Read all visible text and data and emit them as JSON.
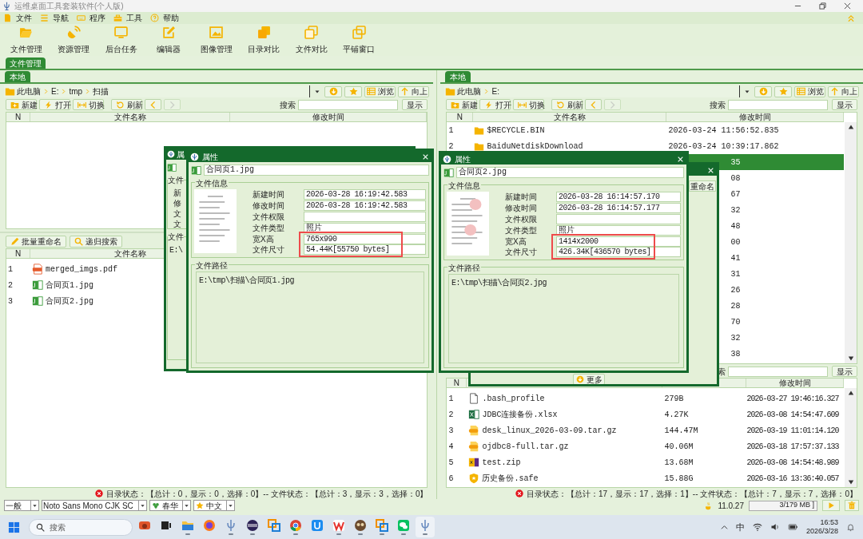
{
  "window": {
    "title": "运维桌面工具套装软件(个人版)"
  },
  "menu": [
    {
      "label": "文件"
    },
    {
      "label": "导航"
    },
    {
      "label": "程序"
    },
    {
      "label": "工具"
    },
    {
      "label": "帮助"
    }
  ],
  "toolbar": [
    {
      "label": "文件管理"
    },
    {
      "label": "资源管理"
    },
    {
      "label": "后台任务"
    },
    {
      "label": "编辑器"
    },
    {
      "label": "图像管理"
    },
    {
      "label": "目录对比"
    },
    {
      "label": "文件对比"
    },
    {
      "label": "平铺窗口"
    }
  ],
  "main_tabs": [
    {
      "label": "文件管理",
      "selected": true
    }
  ],
  "panes": [
    {
      "tab": {
        "label": "本地",
        "selected": true
      },
      "path": [
        "此电脑",
        "E:",
        "tmp",
        "扫描"
      ],
      "nav_buttons": [
        {
          "label": "浏览"
        },
        {
          "label": "向上"
        }
      ],
      "buttons": [
        {
          "label": "新建",
          "disabled": false
        },
        {
          "label": "打开",
          "disabled": false
        },
        {
          "label": "切换",
          "disabled": false
        },
        {
          "label": "刷新",
          "disabled": false
        },
        {
          "disabled": false
        },
        {
          "disabled": true
        }
      ],
      "search_label": "搜索",
      "show_button": "显示",
      "dir_table": {
        "columns": [
          "N",
          "文件名称",
          "修改时间"
        ]
      },
      "file_tools": [
        {
          "label": "批量重命名"
        },
        {
          "label": "递归搜索"
        }
      ],
      "file_table": {
        "columns": [
          "N",
          "文件名称"
        ],
        "rows": [
          {
            "n": "1",
            "name": "merged_imgs.pdf",
            "kind": "pdf"
          },
          {
            "n": "2",
            "name": "合同页1.jpg",
            "kind": "jpg"
          },
          {
            "n": "3",
            "name": "合同页2.jpg",
            "kind": "jpg"
          }
        ]
      },
      "status": "目录状态：【总计：0，显示：0，选择：0】-- 文件状态：【总计：3，显示：3，选择：0】"
    },
    {
      "tab": {
        "label": "本地",
        "selected": true
      },
      "path": [
        "此电脑",
        "E:"
      ],
      "nav_buttons": [
        {
          "label": "浏览"
        },
        {
          "label": "向上"
        }
      ],
      "buttons": [
        {
          "label": "新建",
          "disabled": false
        },
        {
          "label": "打开",
          "disabled": false
        },
        {
          "label": "切换",
          "disabled": false
        },
        {
          "label": "刷新",
          "disabled": false
        },
        {
          "disabled": false
        },
        {
          "disabled": true
        }
      ],
      "search_label": "搜索",
      "show_button": "显示",
      "dir_table": {
        "columns": [
          "N",
          "文件名称",
          "修改时间"
        ],
        "rows": [
          {
            "n": "1",
            "name": "$RECYCLE.BIN",
            "kind": "folder",
            "modified": "2026-03-24 11:56:52.835",
            "selected": false
          },
          {
            "n": "2",
            "name": "BaiduNetdiskDownload",
            "kind": "folder",
            "modified": "2026-03-24 10:39:17.862",
            "selected": false
          },
          {
            "modified": "35",
            "selected": true
          },
          {
            "modified": "08",
            "selected": false
          },
          {
            "modified": "67",
            "selected": false
          },
          {
            "modified": "32",
            "selected": false
          },
          {
            "modified": "48",
            "selected": false
          },
          {
            "modified": "00",
            "selected": false
          },
          {
            "modified": "41",
            "selected": false
          },
          {
            "modified": "31",
            "selected": false
          },
          {
            "modified": "26",
            "selected": false
          },
          {
            "modified": "28",
            "selected": false
          },
          {
            "modified": "70",
            "selected": false
          },
          {
            "modified": "32",
            "selected": false
          },
          {
            "modified": "38",
            "selected": false
          }
        ]
      },
      "lower_search": {
        "label": "索",
        "button": "显示"
      },
      "file_table": {
        "columns": [
          "N",
          "",
          "",
          "修改时间"
        ],
        "rows": [
          {
            "n": "1",
            "name": ".bash_profile",
            "kind": "doc",
            "size": "279B",
            "modified": "2026-03-27 19:46:16.327"
          },
          {
            "n": "2",
            "name": "JDBC连接备份.xlsx",
            "kind": "excel",
            "size": "4.27K",
            "modified": "2026-03-08 14:54:47.609"
          },
          {
            "n": "3",
            "name": "desk_linux_2026-03-09.tar.gz",
            "kind": "gzip",
            "size": "144.47M",
            "modified": "2026-03-19 11:01:14.120"
          },
          {
            "n": "4",
            "name": "ojdbc8-full.tar.gz",
            "kind": "gzip",
            "size": "40.06M",
            "modified": "2026-03-18 17:57:37.133"
          },
          {
            "n": "5",
            "name": "test.zip",
            "kind": "zip",
            "size": "13.68M",
            "modified": "2026-03-08 14:54:48.989"
          },
          {
            "n": "6",
            "name": "历史备份.safe",
            "kind": "shield",
            "size": "15.88G",
            "modified": "2026-03-16 13:36:40.057"
          }
        ]
      },
      "status": "目录状态：【总计：17，显示：17，选择：1】-- 文件状态：【总计：7，显示：7，选择：0】"
    }
  ],
  "dialogs": [
    {
      "kind": "back_left",
      "title": "属",
      "labels": [
        "新",
        "修",
        "文",
        "文"
      ],
      "groups": [
        "文件",
        "文件"
      ],
      "path": "E:\\"
    },
    {
      "kind": "front",
      "title": "属性",
      "file_name": "合同页1.jpg",
      "info_group": "文件信息",
      "fields": [
        {
          "label": "新建时间",
          "value": "2026-03-28 16:19:42.583",
          "highlighted": false
        },
        {
          "label": "修改时间",
          "value": "2026-03-28 16:19:42.583",
          "highlighted": false
        },
        {
          "label": "文件权限",
          "highlighted": false
        },
        {
          "label": "文件类型",
          "value": "照片",
          "highlighted": false
        },
        {
          "label": "宽X高",
          "value": "765x990",
          "highlighted": true
        },
        {
          "label": "文件尺寸",
          "value": "54.44K[55750 bytes]",
          "highlighted": true
        }
      ],
      "path_group": "文件路径",
      "path": "E:\\tmp\\扫描\\合同页1.jpg"
    },
    {
      "kind": "back_right",
      "rename_button": "重命名",
      "more_button": "更多"
    },
    {
      "kind": "front",
      "title": "属性",
      "file_name": "合同页2.jpg",
      "info_group": "文件信息",
      "fields": [
        {
          "label": "新建时间",
          "value": "2026-03-28 16:14:57.170",
          "highlighted": false
        },
        {
          "label": "修改时间",
          "value": "2026-03-28 16:14:57.177",
          "highlighted": false
        },
        {
          "label": "文件权限",
          "highlighted": false
        },
        {
          "label": "文件类型",
          "value": "照片",
          "highlighted": false
        },
        {
          "label": "宽X高",
          "value": "1414x2000",
          "highlighted": true
        },
        {
          "label": "文件尺寸",
          "value": "426.34K[436570 bytes]",
          "highlighted": true
        }
      ],
      "path_group": "文件路径",
      "path": "E:\\tmp\\扫描\\合同页2.jpg"
    }
  ],
  "bottom_bar": {
    "selects": [
      {
        "value": "一般"
      },
      {
        "value": "Noto Sans Mono CJK SC"
      },
      {
        "value": "春华"
      },
      {
        "value": "中文"
      }
    ],
    "java_version": "11.0.27",
    "memory": "3/179 MB ]"
  },
  "taskbar": {
    "search": "搜索",
    "apps": [
      {
        "running": false
      },
      {
        "running": false
      },
      {
        "running": true
      },
      {
        "running": false
      },
      {
        "running": true
      },
      {
        "running": true
      },
      {
        "running": false
      },
      {
        "running": true
      },
      {
        "running": false
      },
      {
        "running": true
      },
      {
        "running": true
      },
      {
        "running": true
      },
      {
        "running": true
      },
      {
        "running": true
      }
    ],
    "ime": "中",
    "time": "16:53",
    "date": "2026/3/28"
  }
}
